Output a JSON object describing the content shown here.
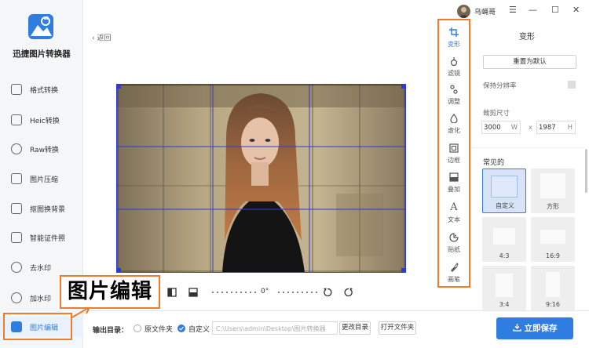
{
  "app": {
    "name": "迅捷图片转换器",
    "user": "乌蝇哥",
    "brand_color": "#2f7de1",
    "annotation_color": "#f07c2a"
  },
  "sidebar": {
    "items": [
      {
        "label": "格式转换",
        "icon": "format-convert-icon"
      },
      {
        "label": "Heic转换",
        "icon": "heic-icon"
      },
      {
        "label": "Raw转换",
        "icon": "raw-icon"
      },
      {
        "label": "图片压缩",
        "icon": "image-compress-icon"
      },
      {
        "label": "抠图换背景",
        "icon": "cutout-icon"
      },
      {
        "label": "智能证件照",
        "icon": "id-photo-icon"
      },
      {
        "label": "去水印",
        "icon": "remove-watermark-icon"
      },
      {
        "label": "加水印",
        "icon": "add-watermark-icon"
      },
      {
        "label": "图片编辑",
        "icon": "image-edit-icon",
        "active": true
      }
    ]
  },
  "titlebar": {
    "menu_glyph": "☰",
    "minimize_glyph": "—",
    "maximize_glyph": "☐",
    "close_glyph": "✕"
  },
  "editor": {
    "back_label": "返回",
    "back_glyph": "‹",
    "rotation": "0°"
  },
  "tools": [
    {
      "label": "变形",
      "icon": "crop-icon",
      "active": true
    },
    {
      "label": "滤镜",
      "icon": "filter-icon"
    },
    {
      "label": "调整",
      "icon": "adjust-icon"
    },
    {
      "label": "虚化",
      "icon": "blur-icon"
    },
    {
      "label": "边框",
      "icon": "border-icon"
    },
    {
      "label": "叠加",
      "icon": "overlay-icon"
    },
    {
      "label": "文本",
      "icon": "text-icon",
      "glyph": "A"
    },
    {
      "label": "贴纸",
      "icon": "sticker-icon"
    },
    {
      "label": "画笔",
      "icon": "brush-icon"
    }
  ],
  "panel": {
    "title": "变形",
    "reset_label": "重置为默认",
    "keep_resolution_label": "保持分辨率",
    "crop_size_label": "裁剪尺寸",
    "width_value": "3000",
    "width_unit": "W",
    "times": "x",
    "height_value": "1987",
    "height_unit": "H",
    "common_label": "常见的",
    "ratios": [
      {
        "label": "自定义",
        "active": true
      },
      {
        "label": "方形"
      },
      {
        "label": "4:3"
      },
      {
        "label": "16:9"
      },
      {
        "label": "3:4"
      },
      {
        "label": "9:16"
      }
    ]
  },
  "output": {
    "label": "输出目录：",
    "option_original": "原文件夹",
    "option_custom": "自定义",
    "path_value": "C:\\Users\\admin\\Desktop\\图片转换器",
    "change_dir_label": "更改目录",
    "open_folder_label": "打开文件夹",
    "save_label": "立即保存"
  },
  "annotation": {
    "text": "图片编辑"
  }
}
